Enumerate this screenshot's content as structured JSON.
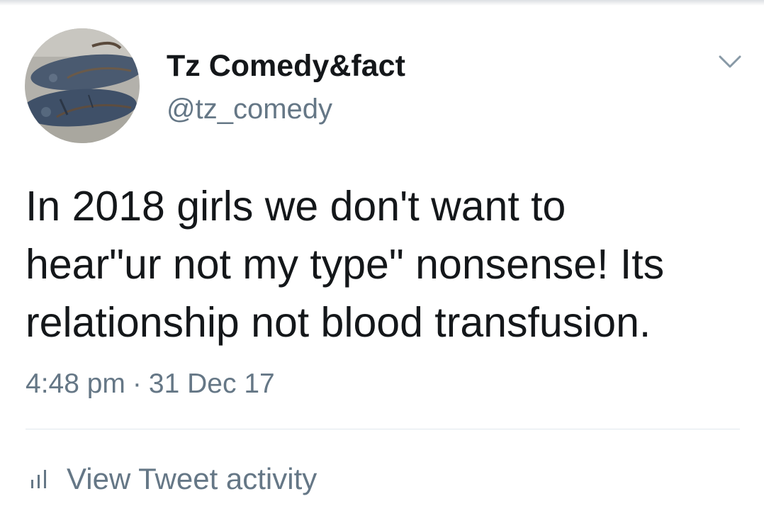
{
  "tweet": {
    "author": {
      "display_name": "Tz Comedy&fact",
      "handle": "@tz_comedy",
      "avatar_icon": "avatar-sandals-photo"
    },
    "menu_icon": "chevron-down-icon",
    "text_lines": [
      "In 2018 girls we don't want to",
      "hear\"ur not my type\" nonsense! Its",
      "relationship not blood transfusion."
    ],
    "time": "4:48 pm",
    "separator": "·",
    "date": "31 Dec 17"
  },
  "footer": {
    "activity_icon": "bar-chart-icon",
    "activity_label": "View Tweet activity"
  },
  "colors": {
    "text_primary": "#14171a",
    "text_secondary": "#657786",
    "divider": "#e1e8ed",
    "background": "#ffffff"
  }
}
